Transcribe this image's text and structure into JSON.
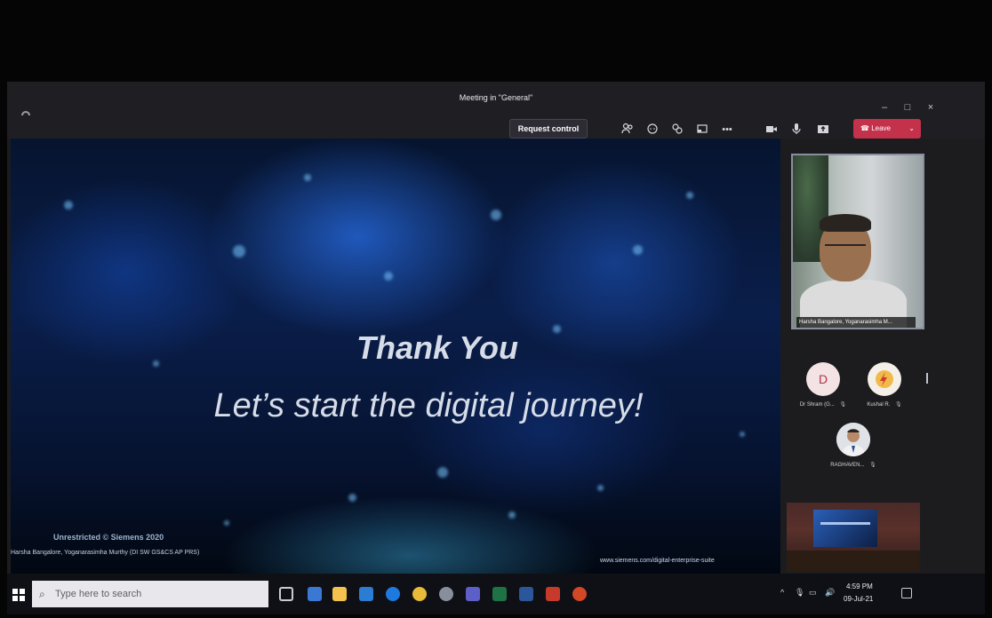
{
  "window": {
    "title": "Meeting in \"General\"",
    "controls": {
      "minimize": "–",
      "maximize": "□",
      "close": "×"
    }
  },
  "toolbar": {
    "request_control_label": "Request control",
    "icons": [
      "participants-icon",
      "chat-icon",
      "reactions-icon",
      "rooms-icon",
      "more-options-icon",
      "camera-icon",
      "mic-icon",
      "share-icon"
    ],
    "leave_label": "Leave"
  },
  "slide": {
    "heading": "Thank You",
    "tagline": "Let’s start the digital journey!",
    "classification": "Unrestricted © Siemens 2020",
    "presenter": "Harsha Bangalore, Yoganarasimha Murthy (DI SW GS&CS AP PRS)",
    "url": "www.siemens.com/digital-enterprise-suite"
  },
  "video_tile": {
    "name": "Harsha Bangalore, Yoganarasimha M..."
  },
  "participants": [
    {
      "initial": "D",
      "name": "Dr Shram (G..."
    },
    {
      "initial": "",
      "name": "Kushal R."
    },
    {
      "initial": "",
      "name": "RAGHAVEN..."
    }
  ],
  "taskbar": {
    "search_placeholder": "Type here to search",
    "time": "4:59 PM",
    "date": "09-Jul-21"
  },
  "colors": {
    "leave_button": "#c4314b",
    "toolbar_bg": "#1f1f23",
    "taskbar_bg": "#0f1016"
  }
}
